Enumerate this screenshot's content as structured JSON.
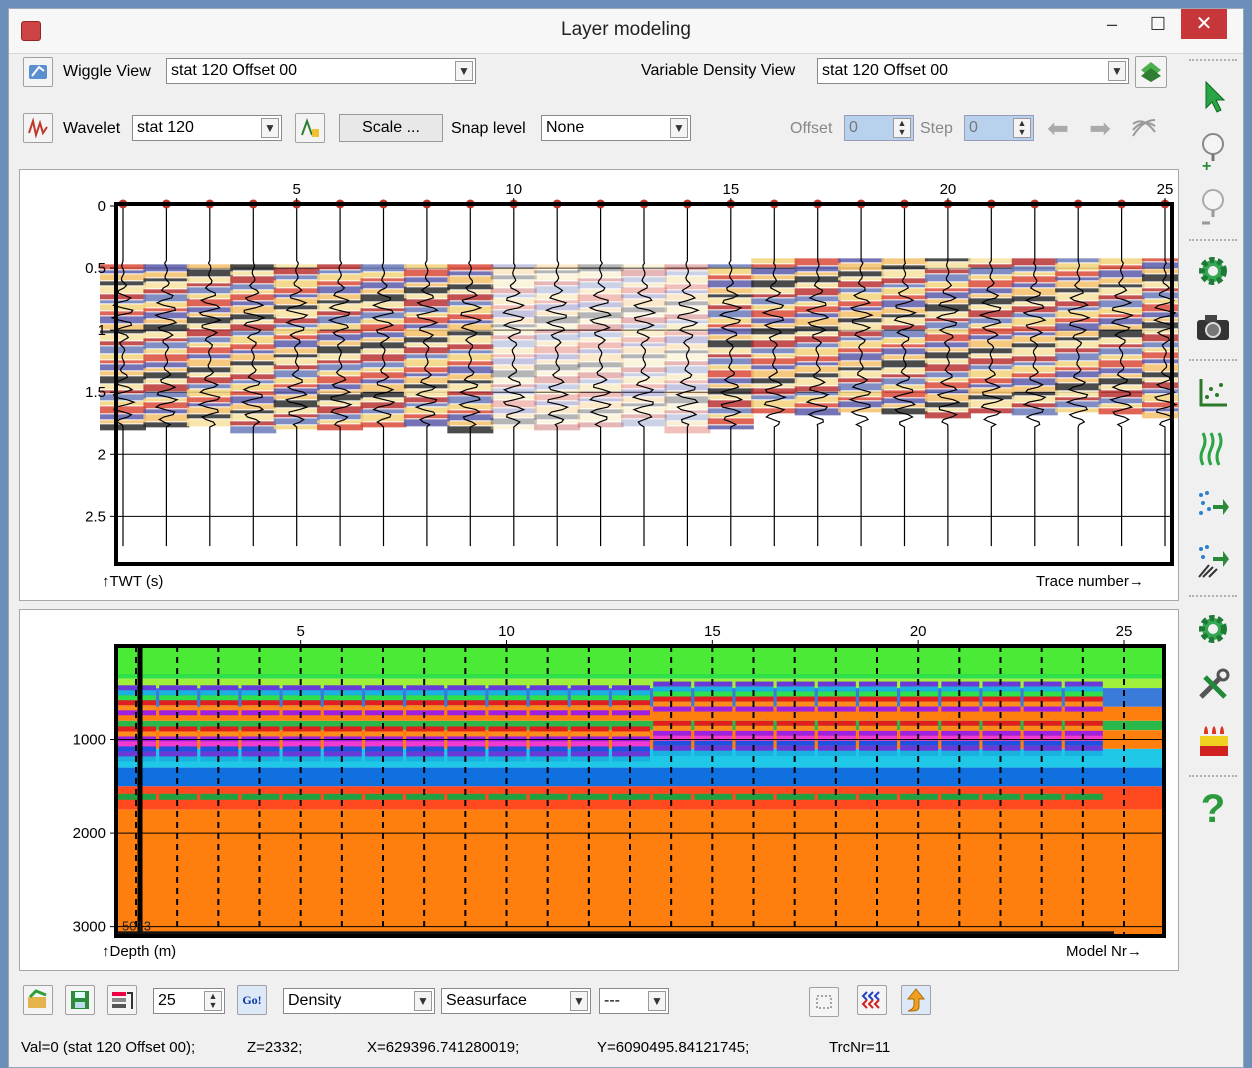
{
  "window": {
    "title": "Layer modeling",
    "minimize": "–",
    "maximize": "☐",
    "close": "✕"
  },
  "toolbar1": {
    "wiggle_label": "Wiggle View",
    "wiggle_value": "stat 120 Offset 00",
    "vd_label": "Variable Density View",
    "vd_value": "stat 120 Offset 00"
  },
  "toolbar2": {
    "wavelet_label": "Wavelet",
    "wavelet_value": "stat 120",
    "scale_button": "Scale ...",
    "snap_label": "Snap level",
    "snap_value": "None",
    "offset_label": "Offset",
    "offset_value": "0",
    "step_label": "Step",
    "step_value": "0"
  },
  "top_panel": {
    "x_ticks": [
      "5",
      "10",
      "15",
      "20",
      "25"
    ],
    "y_ticks": [
      "0",
      "0.5",
      "1",
      "1.5",
      "2",
      "2.5"
    ],
    "y_label": "TWT (s)",
    "x_label": "Trace number"
  },
  "bottom_panel": {
    "x_ticks": [
      "5",
      "10",
      "15",
      "20",
      "25"
    ],
    "y_ticks": [
      "1000",
      "2000",
      "3000"
    ],
    "y_label": "Depth (m)",
    "x_label": "Model Nr",
    "marker_text": "5013"
  },
  "bottom_bar": {
    "count_value": "25",
    "property_value": "Density",
    "surface_value": "Seasurface",
    "extra_value": "---",
    "go_label": "Go!"
  },
  "status": {
    "val": "Val=0 (stat 120 Offset 00);",
    "z": "Z=2332;",
    "x": "X=629396.741280019;",
    "y": "Y=6090495.84121745;",
    "trc": "TrcNr=11"
  },
  "icons": {
    "right_toolbar": [
      "pointer-icon",
      "zoom-in-icon",
      "zoom-out-icon",
      "settings-icon",
      "camera-icon",
      "crossplot-icon",
      "wiggle-traces-icon",
      "flatten-icon",
      "flatten-advanced-icon",
      "settings-icon",
      "tools-icon",
      "fluid-icon",
      "help-icon"
    ]
  }
}
